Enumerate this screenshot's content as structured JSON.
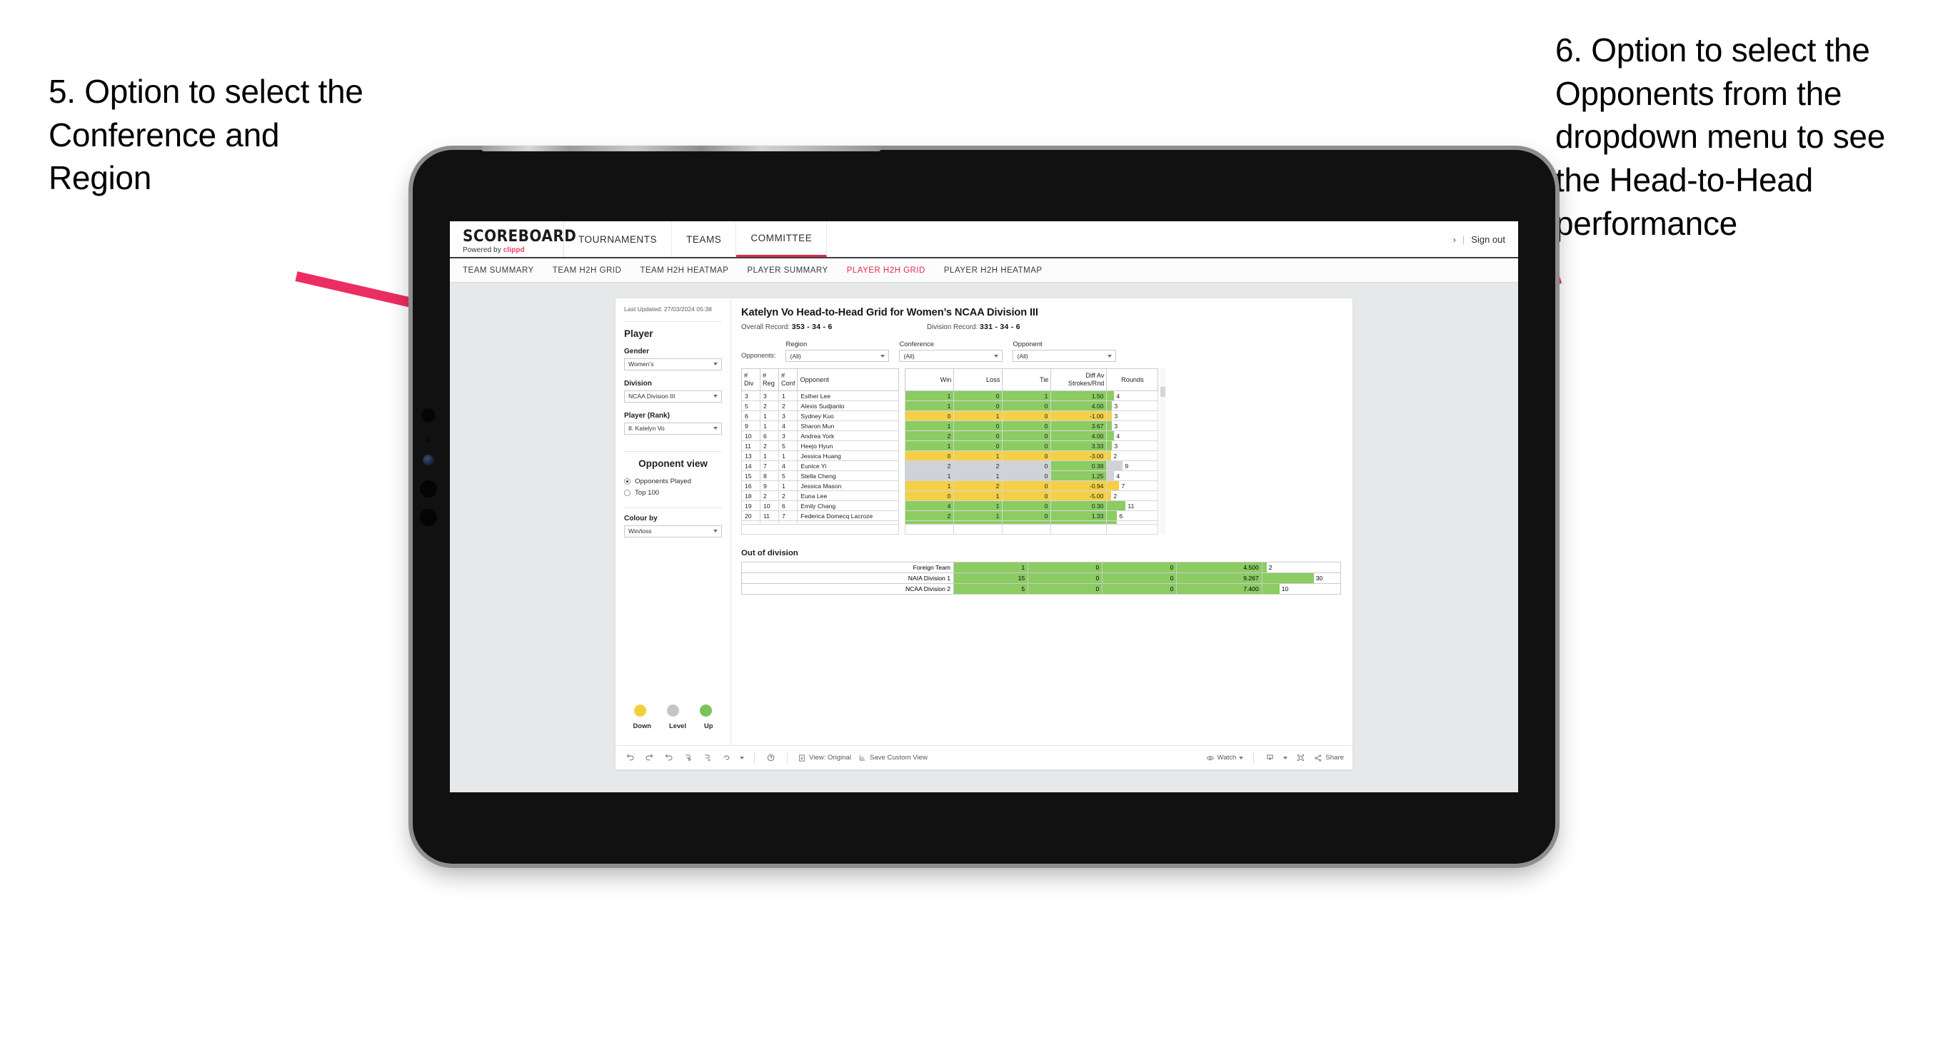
{
  "annotations": {
    "left": "5. Option to select the Conference and Region",
    "right": "6. Option to select the Opponents from the dropdown menu to see the Head-to-Head performance",
    "arrow_color": "#ec2d62"
  },
  "app": {
    "brand": {
      "title": "SCOREBOARD",
      "powered_prefix": "Powered by ",
      "powered_brand": "clippd"
    },
    "topnav": [
      {
        "label": "TOURNAMENTS",
        "active": false
      },
      {
        "label": "TEAMS",
        "active": false
      },
      {
        "label": "COMMITTEE",
        "active": true
      }
    ],
    "topbar_right": {
      "chevron": "›",
      "separator": "|",
      "sign_out": "Sign out"
    },
    "subnav": [
      {
        "label": "TEAM SUMMARY",
        "active": false
      },
      {
        "label": "TEAM H2H GRID",
        "active": false
      },
      {
        "label": "TEAM H2H HEATMAP",
        "active": false
      },
      {
        "label": "PLAYER SUMMARY",
        "active": false
      },
      {
        "label": "PLAYER H2H GRID",
        "active": true
      },
      {
        "label": "PLAYER H2H HEATMAP",
        "active": false
      }
    ],
    "accent_color": "#e5274f"
  },
  "sidebar": {
    "last_updated": "Last Updated: 27/03/2024 05:38",
    "player_heading": "Player",
    "fields": [
      {
        "label": "Gender",
        "value": "Women’s"
      },
      {
        "label": "Division",
        "value": "NCAA Division III"
      },
      {
        "label": "Player (Rank)",
        "value": "8. Katelyn Vo"
      }
    ],
    "opponent_view": {
      "heading": "Opponent view",
      "options": [
        {
          "label": "Opponents Played",
          "selected": true
        },
        {
          "label": "Top 100",
          "selected": false
        }
      ]
    },
    "colour_by": {
      "label": "Colour by",
      "value": "Win/loss"
    },
    "legend": [
      {
        "label": "Down",
        "color": "#f2cf3d"
      },
      {
        "label": "Level",
        "color": "#c2c6cb"
      },
      {
        "label": "Up",
        "color": "#7cc35a"
      }
    ]
  },
  "main": {
    "title": "Katelyn Vo Head-to-Head Grid for Women’s NCAA Division III",
    "overall_record_label": "Overall Record: ",
    "overall_record_value": "353 - 34 - 6",
    "division_record_label": "Division Record: ",
    "division_record_value": "331 - 34 - 6",
    "opponents_label": "Opponents:",
    "filters": [
      {
        "label": "Region",
        "value": "(All)"
      },
      {
        "label": "Conference",
        "value": "(All)"
      },
      {
        "label": "Opponent",
        "value": "(All)"
      }
    ],
    "grid": {
      "headers": [
        "# Div",
        "# Reg",
        "# Conf",
        "Opponent",
        "Win",
        "Loss",
        "Tie",
        "Diff Av Strokes/Rnd",
        "Rounds"
      ],
      "header_lines": [
        [
          "#",
          "Div"
        ],
        [
          "#",
          "Reg"
        ],
        [
          "#",
          "Conf"
        ],
        [
          "Opponent"
        ],
        [
          "Win"
        ],
        [
          "Loss"
        ],
        [
          "Tie"
        ],
        [
          "Diff Av",
          "Strokes/Rnd"
        ],
        [
          "Rounds"
        ]
      ],
      "max_rounds": 30,
      "rows": [
        {
          "div": "3",
          "reg": "3",
          "conf": "1",
          "opponent": "Esther Lee",
          "win": "1",
          "loss": "0",
          "tie": "1",
          "diff": "1.50",
          "rounds": 4,
          "state": "up"
        },
        {
          "div": "5",
          "reg": "2",
          "conf": "2",
          "opponent": "Alexis Sudjianto",
          "win": "1",
          "loss": "0",
          "tie": "0",
          "diff": "4.00",
          "rounds": 3,
          "state": "up"
        },
        {
          "div": "6",
          "reg": "1",
          "conf": "3",
          "opponent": "Sydney Kuo",
          "win": "0",
          "loss": "1",
          "tie": "0",
          "diff": "-1.00",
          "rounds": 3,
          "state": "down"
        },
        {
          "div": "9",
          "reg": "1",
          "conf": "4",
          "opponent": "Sharon Mun",
          "win": "1",
          "loss": "0",
          "tie": "0",
          "diff": "3.67",
          "rounds": 3,
          "state": "up"
        },
        {
          "div": "10",
          "reg": "6",
          "conf": "3",
          "opponent": "Andrea York",
          "win": "2",
          "loss": "0",
          "tie": "0",
          "diff": "4.00",
          "rounds": 4,
          "state": "up"
        },
        {
          "div": "11",
          "reg": "2",
          "conf": "5",
          "opponent": "Heejo Hyun",
          "win": "1",
          "loss": "0",
          "tie": "0",
          "diff": "3.33",
          "rounds": 3,
          "state": "up"
        },
        {
          "div": "13",
          "reg": "1",
          "conf": "1",
          "opponent": "Jessica Huang",
          "win": "0",
          "loss": "1",
          "tie": "0",
          "diff": "-3.00",
          "rounds": 2,
          "state": "down"
        },
        {
          "div": "14",
          "reg": "7",
          "conf": "4",
          "opponent": "Eunice Yi",
          "win": "2",
          "loss": "2",
          "tie": "0",
          "diff": "0.38",
          "rounds": 9,
          "state": "level",
          "diff_state": "up"
        },
        {
          "div": "15",
          "reg": "8",
          "conf": "5",
          "opponent": "Stella Cheng",
          "win": "1",
          "loss": "1",
          "tie": "0",
          "diff": "1.25",
          "rounds": 4,
          "state": "level",
          "diff_state": "up"
        },
        {
          "div": "16",
          "reg": "9",
          "conf": "1",
          "opponent": "Jessica Mason",
          "win": "1",
          "loss": "2",
          "tie": "0",
          "diff": "-0.94",
          "rounds": 7,
          "state": "down"
        },
        {
          "div": "18",
          "reg": "2",
          "conf": "2",
          "opponent": "Euna Lee",
          "win": "0",
          "loss": "1",
          "tie": "0",
          "diff": "-5.00",
          "rounds": 2,
          "state": "down"
        },
        {
          "div": "19",
          "reg": "10",
          "conf": "6",
          "opponent": "Emily Chang",
          "win": "4",
          "loss": "1",
          "tie": "0",
          "diff": "0.30",
          "rounds": 11,
          "state": "up"
        },
        {
          "div": "20",
          "reg": "11",
          "conf": "7",
          "opponent": "Federica Domecq Lacroze",
          "win": "2",
          "loss": "1",
          "tie": "0",
          "diff": "1.33",
          "rounds": 6,
          "state": "up"
        }
      ]
    },
    "out_of_division": {
      "title": "Out of division",
      "max_rounds": 30,
      "rows": [
        {
          "name": "Foreign Team",
          "win": "1",
          "loss": "0",
          "tie": "0",
          "diff": "4.500",
          "rounds": 2,
          "state": "up"
        },
        {
          "name": "NAIA Division 1",
          "win": "15",
          "loss": "0",
          "tie": "0",
          "diff": "9.267",
          "rounds": 30,
          "state": "up"
        },
        {
          "name": "NCAA Division 2",
          "win": "5",
          "loss": "0",
          "tie": "0",
          "diff": "7.400",
          "rounds": 10,
          "state": "up"
        }
      ]
    }
  },
  "toolbar": {
    "undo": "undo-icon",
    "redo": "redo-icon",
    "revert": "revert-icon",
    "refresh": "refresh-data-icon",
    "pause": "pause-updates-icon",
    "highlight": "highlight-icon",
    "help": "help-icon",
    "view_label": "View: Original",
    "save_label": "Save Custom View",
    "watch_label": "Watch",
    "download": "download-icon",
    "fullscreen": "fullscreen-icon",
    "share_label": "Share"
  },
  "colors": {
    "up": "#8ccc63",
    "down": "#f5d047",
    "level": "#cfd2d6",
    "accent": "#e5274f"
  }
}
